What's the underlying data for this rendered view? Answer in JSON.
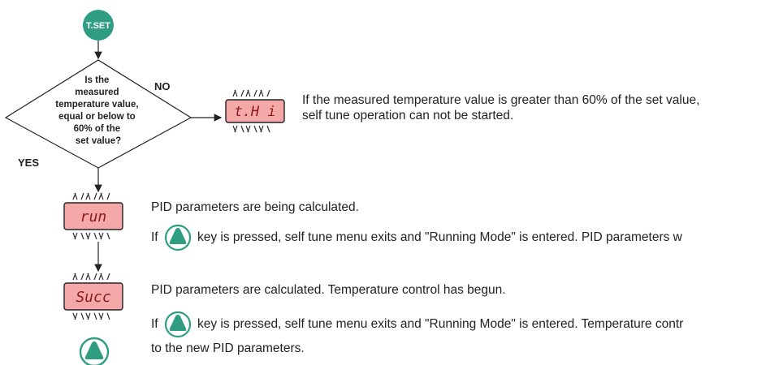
{
  "start": {
    "label": "T.SET",
    "color": "#2e9d82"
  },
  "decision": {
    "lines": [
      "Is the",
      "measured",
      "temperature value,",
      "equal or below to",
      "60% of the",
      "set value?"
    ],
    "no_label": "NO",
    "yes_label": "YES"
  },
  "displays": {
    "high": "t.H i",
    "run": "run",
    "succ": "Succ",
    "bg_color": "#f5a8a8",
    "text_color": "#8a1a1a"
  },
  "notes": {
    "high_line1": "If the measured temperature value is greater than 60% of the set value,",
    "high_line2": "self tune operation can not be started.",
    "run_line1": "PID parameters are being calculated.",
    "run_line2_prefix": "If",
    "run_line2_rest": "key is pressed, self tune menu exits and \"Running Mode\" is entered. PID parameters w",
    "succ_line1": "PID parameters are calculated. Temperature control has begun.",
    "succ_line2_prefix": "If",
    "succ_line2_rest": "key is pressed, self tune menu exits and \"Running Mode\" is entered. Temperature contr",
    "succ_line3": "to the new PID parameters."
  },
  "key_icon": "up-triangle-key-icon",
  "key_color": "#2e9d82"
}
